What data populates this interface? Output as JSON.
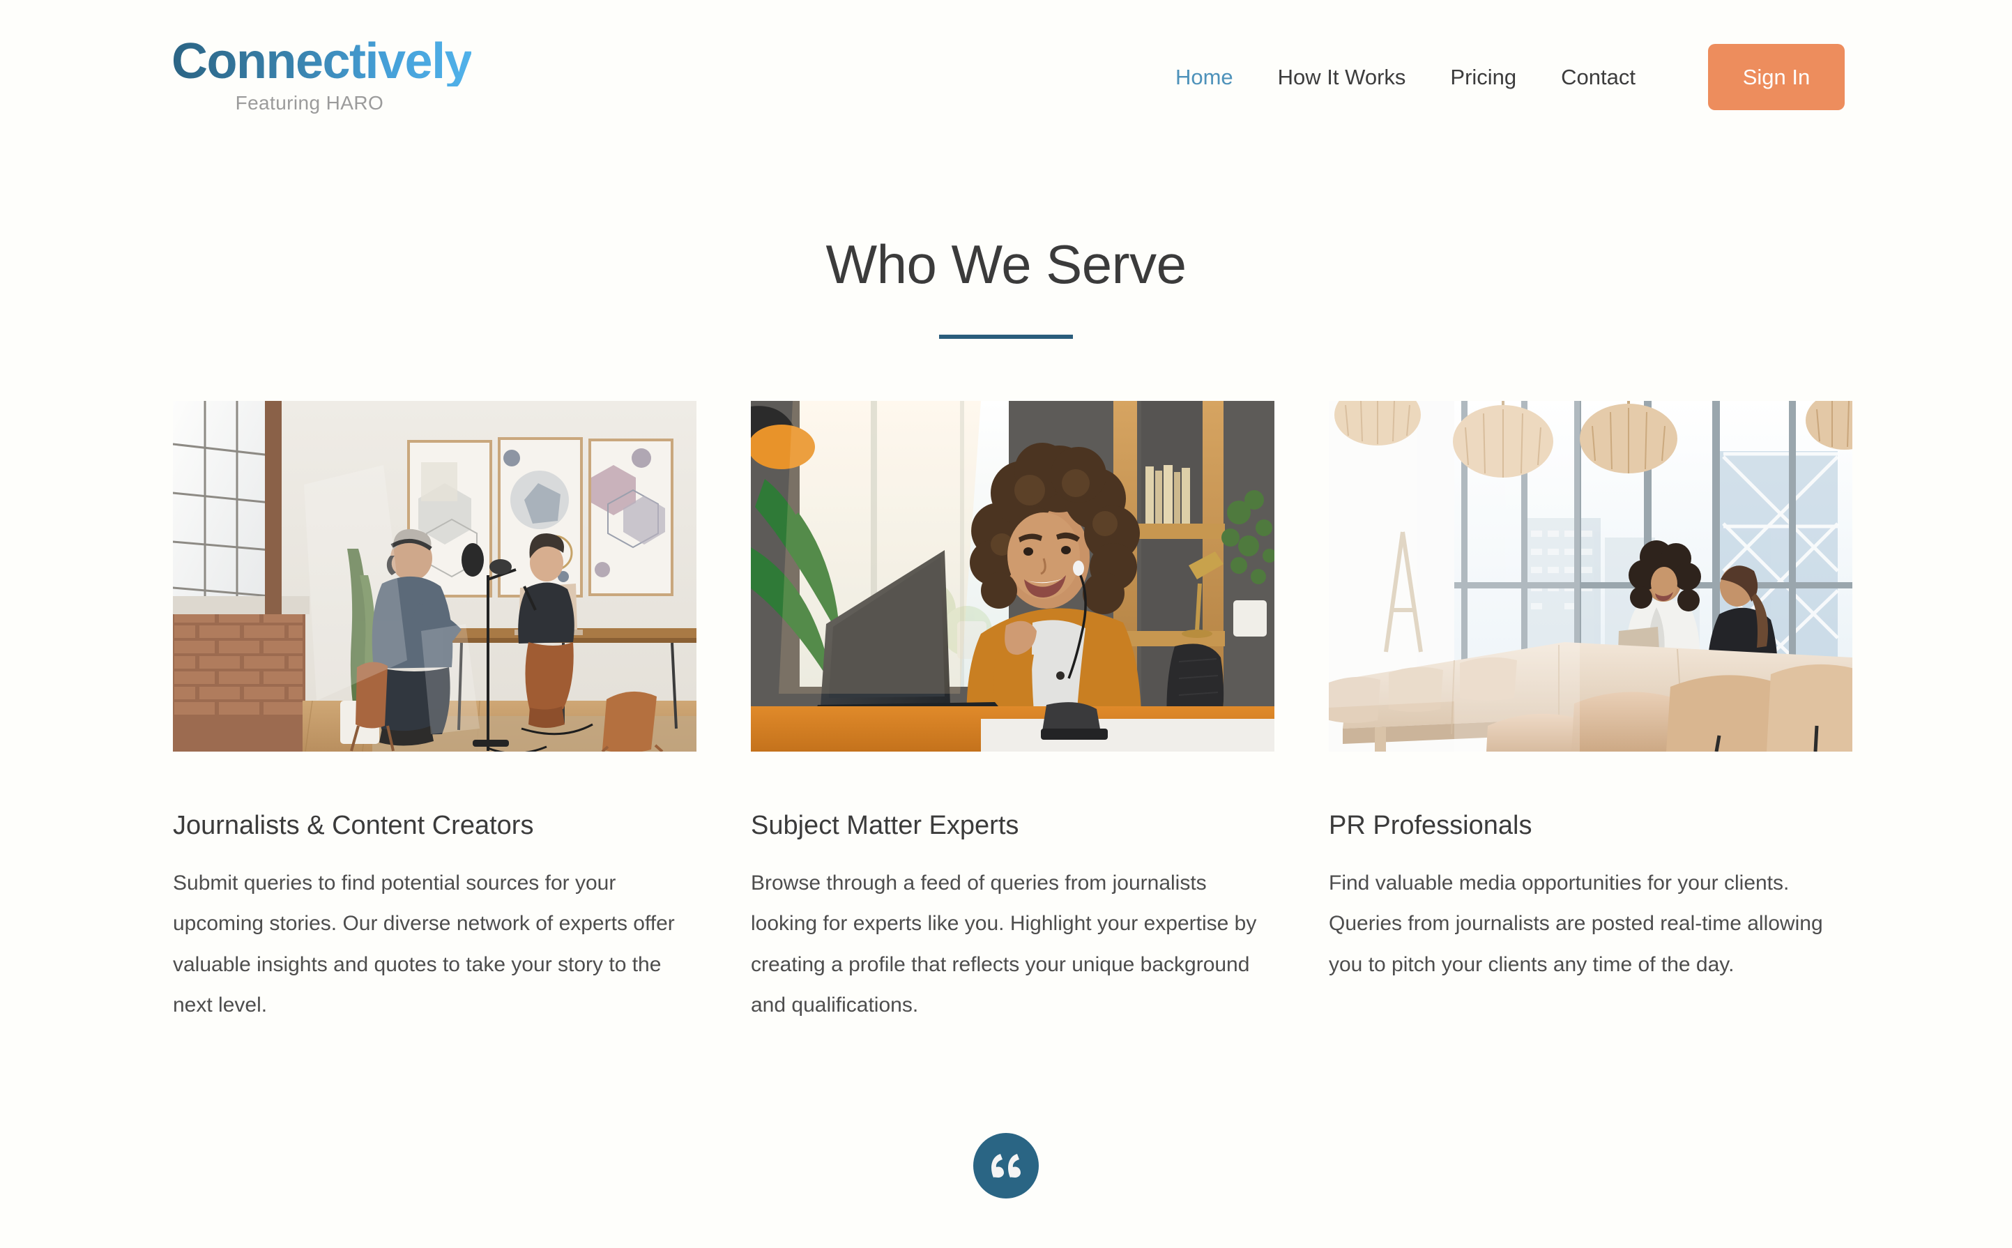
{
  "brand": {
    "wordmark": "Connectively",
    "tagline": "Featuring HARO",
    "gradient_start": "#2b6484",
    "gradient_end": "#51b2ea",
    "tagline_color": "#9b9b9b"
  },
  "nav": {
    "items": [
      {
        "label": "Home",
        "active": true
      },
      {
        "label": "How It Works",
        "active": false
      },
      {
        "label": "Pricing",
        "active": false
      },
      {
        "label": "Contact",
        "active": false
      }
    ],
    "active_color": "#4e92ba",
    "inactive_color": "#3c3c3c",
    "signin_label": "Sign In",
    "signin_bg": "#ed8d5d",
    "signin_text_color": "#ffffff"
  },
  "section": {
    "title": "Who We Serve",
    "title_color": "#3b3b3b",
    "divider_color": "#2a5d7c"
  },
  "cards": [
    {
      "title": "Journalists & Content Creators",
      "body": "Submit queries to find potential sources for your upcoming stories. Our diverse network of experts offer valuable insights and quotes to take your story to the next level.",
      "image_alt": "Podcast studio interview: two people seated at a wooden table with microphones, brick wall, large industrial window and framed abstract art"
    },
    {
      "title": "Subject Matter Experts",
      "body": "Browse through a feed of queries from journalists looking for experts like you. Highlight your expertise by creating a profile that reflects your unique background and qualifications.",
      "image_alt": "Smiling woman with curly hair in a mustard jacket wearing earbuds at a laptop in a warm home office with bookshelf and plants"
    },
    {
      "title": "PR Professionals",
      "body": "Find valuable media opportunities for your clients. Queries from journalists are posted real-time allowing you to pitch your clients any time of the day.",
      "image_alt": "Two women in conversation at a light wood conference table in a bright high-rise meeting room with rattan pendant lights and city-view windows"
    }
  ],
  "quote_badge": {
    "glyph": "quote-icon",
    "bg": "#2a6584",
    "fg": "#f4f4f4"
  },
  "page": {
    "background": "#fefefb"
  }
}
